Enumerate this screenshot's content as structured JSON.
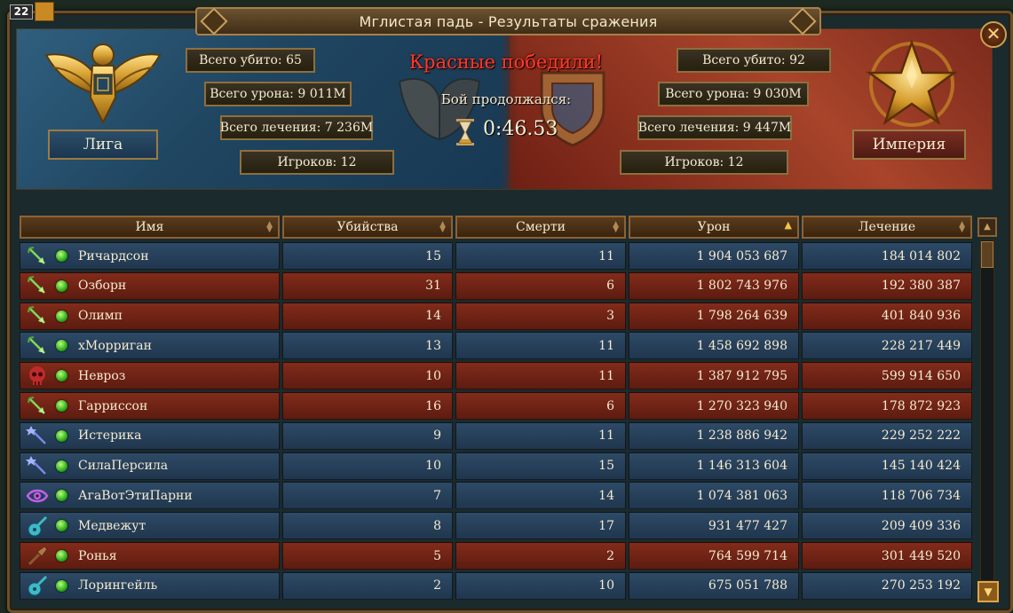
{
  "window": {
    "title": "Мглистая падь - Результаты сражения",
    "close_label": "✕",
    "player_level": "22"
  },
  "battle": {
    "result": "Красные победили!",
    "duration_label": "Бой продолжался:",
    "duration_value": "0:46.53"
  },
  "league": {
    "name": "Лига",
    "total_kills": "Всего убито: 65",
    "total_damage": "Всего урона: 9 011M",
    "total_healing": "Всего лечения: 7 236M",
    "players": "Игроков: 12",
    "color": "#2f5f7e"
  },
  "empire": {
    "name": "Империя",
    "total_kills": "Всего убито: 92",
    "total_damage": "Всего урона: 9 030M",
    "total_healing": "Всего лечения: 9 447M",
    "players": "Игроков: 12",
    "color": "#a8442a"
  },
  "table": {
    "columns": [
      "Имя",
      "Убийства",
      "Смерти",
      "Урон",
      "Лечение"
    ],
    "sorted_column": "Урон",
    "rows": [
      {
        "team": "blue",
        "class_icon": "archer-arrow-icon",
        "name": "Ричардсон",
        "kills": "15",
        "deaths": "11",
        "damage": "1 904 053 687",
        "healing": "184 014 802"
      },
      {
        "team": "red",
        "class_icon": "archer-arrow-icon",
        "name": "Озборн",
        "kills": "31",
        "deaths": "6",
        "damage": "1 802 743 976",
        "healing": "192 380 387"
      },
      {
        "team": "red",
        "class_icon": "archer-arrow-icon",
        "name": "Олимп",
        "kills": "14",
        "deaths": "3",
        "damage": "1 798 264 639",
        "healing": "401 840 936"
      },
      {
        "team": "blue",
        "class_icon": "archer-arrow-icon",
        "name": "хМорриган",
        "kills": "13",
        "deaths": "11",
        "damage": "1 458 692 898",
        "healing": "228 217 449"
      },
      {
        "team": "red",
        "class_icon": "necromancer-skull-icon",
        "name": "Невроз",
        "kills": "10",
        "deaths": "11",
        "damage": "1 387 912 795",
        "healing": "599 914 650"
      },
      {
        "team": "red",
        "class_icon": "archer-arrow-icon",
        "name": "Гарриссон",
        "kills": "16",
        "deaths": "6",
        "damage": "1 270 323 940",
        "healing": "178 872 923"
      },
      {
        "team": "blue",
        "class_icon": "mage-staff-icon",
        "name": "Истерика",
        "kills": "9",
        "deaths": "11",
        "damage": "1 238 886 942",
        "healing": "229 252 222"
      },
      {
        "team": "blue",
        "class_icon": "mage-staff-icon",
        "name": "СилаПерсила",
        "kills": "10",
        "deaths": "15",
        "damage": "1 146 313 604",
        "healing": "145 140 424"
      },
      {
        "team": "blue",
        "class_icon": "psionic-eye-icon",
        "name": "АгаВотЭтиПарни",
        "kills": "7",
        "deaths": "14",
        "damage": "1 074 381 063",
        "healing": "118 706 734"
      },
      {
        "team": "blue",
        "class_icon": "bard-lute-icon",
        "name": "Медвежут",
        "kills": "8",
        "deaths": "17",
        "damage": "931 477 427",
        "healing": "209 409 336"
      },
      {
        "team": "red",
        "class_icon": "warrior-club-icon",
        "name": "Ронья",
        "kills": "5",
        "deaths": "2",
        "damage": "764 599 714",
        "healing": "301 449 520"
      },
      {
        "team": "blue",
        "class_icon": "bard-lute-icon",
        "name": "Лорингейль",
        "kills": "2",
        "deaths": "10",
        "damage": "675 051 788",
        "healing": "270 253 192"
      }
    ]
  }
}
